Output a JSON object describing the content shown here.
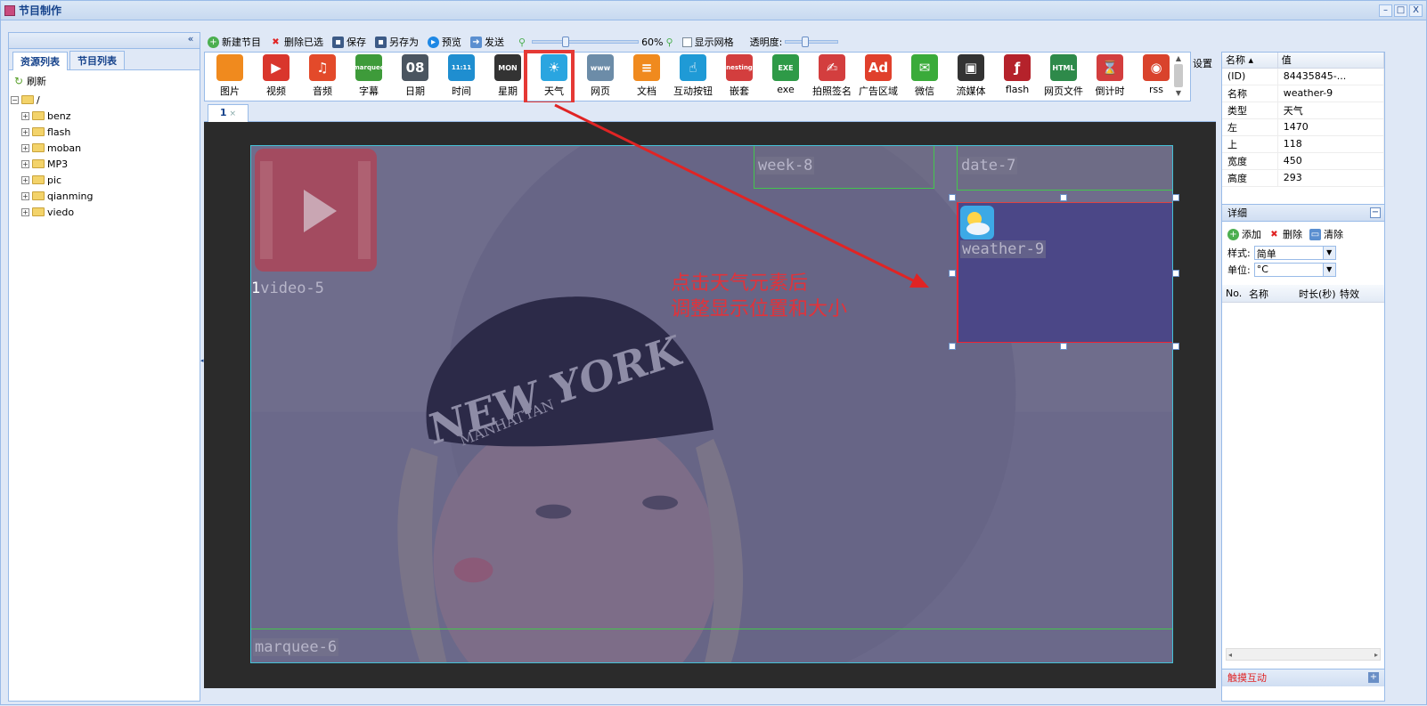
{
  "window": {
    "title": "节目制作",
    "controls": [
      "–",
      "□",
      "X"
    ]
  },
  "left": {
    "collapse": "«",
    "tabs": [
      "资源列表",
      "节目列表"
    ],
    "refresh": "刷新",
    "root": "/",
    "folders": [
      "benz",
      "flash",
      "moban",
      "MP3",
      "pic",
      "qianming",
      "viedo"
    ]
  },
  "toolbar": {
    "new": "新建节目",
    "delete": "删除已选",
    "save": "保存",
    "saveas": "另存为",
    "preview": "预览",
    "send": "发送",
    "zoom": "60%",
    "zoom_level": 0.3,
    "grid": "显示网格",
    "opacity": "透明度:",
    "opacity_level": 0.35
  },
  "palette": {
    "items": [
      {
        "label": "图片",
        "icon": "image-icon",
        "color": "#f08a1e",
        "glyph": ""
      },
      {
        "label": "视频",
        "icon": "video-icon",
        "color": "#d9362c",
        "glyph": "▶"
      },
      {
        "label": "音频",
        "icon": "audio-icon",
        "color": "#e34a2a",
        "glyph": "♫"
      },
      {
        "label": "字幕",
        "icon": "marquee-icon",
        "color": "#3e9b3a",
        "glyph": "marquee"
      },
      {
        "label": "日期",
        "icon": "date-icon",
        "color": "#4b5560",
        "glyph": "08"
      },
      {
        "label": "时间",
        "icon": "time-icon",
        "color": "#1f8ed0",
        "glyph": "11:11"
      },
      {
        "label": "星期",
        "icon": "week-icon",
        "color": "#333333",
        "glyph": "MON"
      },
      {
        "label": "天气",
        "icon": "weather-icon",
        "color": "#2aa5e0",
        "glyph": "☀"
      },
      {
        "label": "网页",
        "icon": "webpage-icon",
        "color": "#6c8ca8",
        "glyph": "www"
      },
      {
        "label": "文档",
        "icon": "document-icon",
        "color": "#f08a1e",
        "glyph": "≡"
      },
      {
        "label": "互动按钮",
        "icon": "interactive-button-icon",
        "color": "#1f9ad6",
        "glyph": "☝"
      },
      {
        "label": "嵌套",
        "icon": "nesting-icon",
        "color": "#d33e3e",
        "glyph": "nesting"
      },
      {
        "label": "exe",
        "icon": "exe-icon",
        "color": "#2e9a47",
        "glyph": "EXE"
      },
      {
        "label": "拍照签名",
        "icon": "photo-sign-icon",
        "color": "#d33e3e",
        "glyph": "✍"
      },
      {
        "label": "广告区域",
        "icon": "ad-area-icon",
        "color": "#e0402c",
        "glyph": "Ad"
      },
      {
        "label": "微信",
        "icon": "wechat-icon",
        "color": "#3aab3a",
        "glyph": "✉"
      },
      {
        "label": "流媒体",
        "icon": "streaming-icon",
        "color": "#333333",
        "glyph": "▣"
      },
      {
        "label": "flash",
        "icon": "flash-icon",
        "color": "#b5222b",
        "glyph": "ƒ"
      },
      {
        "label": "网页文件",
        "icon": "html-file-icon",
        "color": "#2e8a4a",
        "glyph": "HTML"
      },
      {
        "label": "倒计时",
        "icon": "countdown-icon",
        "color": "#d33e3e",
        "glyph": "⌛"
      },
      {
        "label": "rss",
        "icon": "rss-icon",
        "color": "#d9432c",
        "glyph": "◉"
      }
    ],
    "settings": "设置"
  },
  "doc_tab": {
    "label": "1",
    "close": "×"
  },
  "stage": {
    "elements": {
      "week": "week-8",
      "date": "date-7",
      "weather": "weather-9",
      "video": "video-5",
      "video_prefix": "1",
      "marquee": "marquee-6"
    },
    "note": [
      "点击天气元素后",
      "调整显示位置和大小"
    ],
    "hat_text": "NEW YORK",
    "hat_sub": "MANHATTAN"
  },
  "props": {
    "headers": [
      "名称 ▴",
      "值"
    ],
    "rows": [
      {
        "k": "(ID)",
        "v": "84435845-..."
      },
      {
        "k": "名称",
        "v": "weather-9"
      },
      {
        "k": "类型",
        "v": "天气"
      },
      {
        "k": "左",
        "v": "1470"
      },
      {
        "k": "上",
        "v": "118"
      },
      {
        "k": "宽度",
        "v": "450"
      },
      {
        "k": "高度",
        "v": "293"
      }
    ]
  },
  "detail": {
    "title": "详细",
    "collapse": "−",
    "add": "添加",
    "delete": "删除",
    "clear": "清除",
    "style_label": "样式:",
    "style_value": "简单",
    "unit_label": "单位:",
    "unit_value": "°C",
    "list_headers": [
      "No.",
      "名称",
      "时长(秒)",
      "特效"
    ]
  },
  "touch": {
    "title": "触摸互动",
    "plus": "+"
  }
}
